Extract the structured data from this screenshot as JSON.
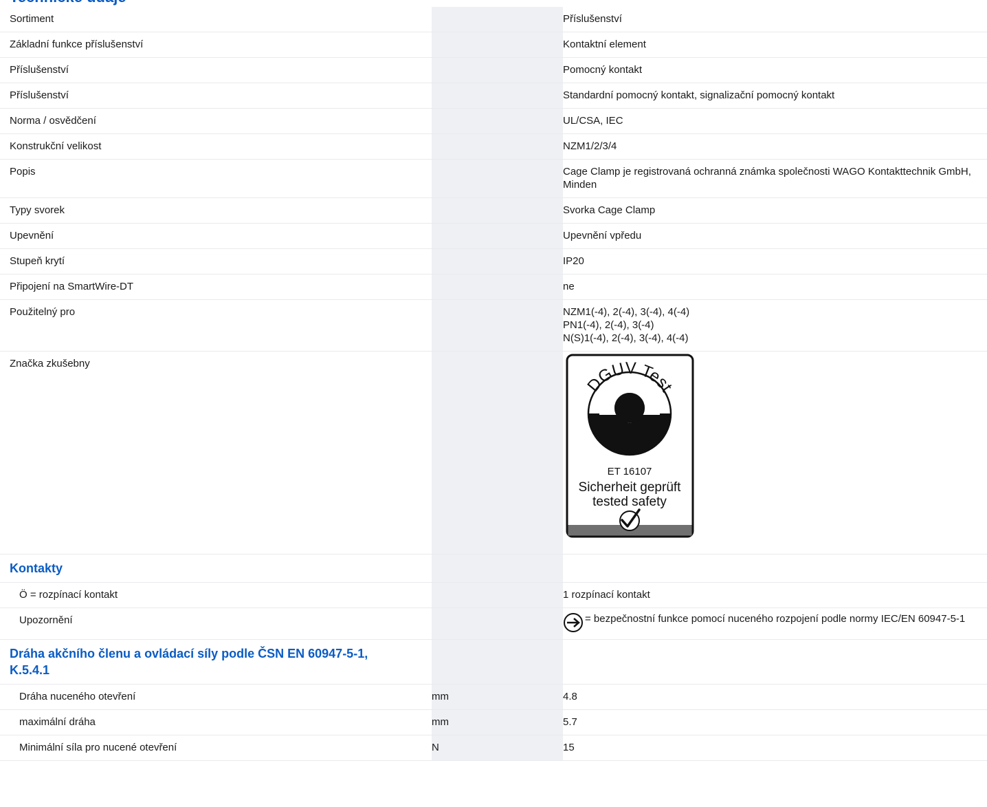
{
  "page": {
    "title_partial": "Technické údaje"
  },
  "general_rows": [
    {
      "label": "Sortiment",
      "unit": "",
      "value": "Příslušenství"
    },
    {
      "label": "Základní funkce příslušenství",
      "unit": "",
      "value": "Kontaktní element"
    },
    {
      "label": "Příslušenství",
      "unit": "",
      "value": "Pomocný kontakt"
    },
    {
      "label": "Příslušenství",
      "unit": "",
      "value": "Standardní pomocný kontakt, signalizační pomocný kontakt"
    },
    {
      "label": "Norma / osvědčení",
      "unit": "",
      "value": "UL/CSA, IEC"
    },
    {
      "label": "Konstrukční velikost",
      "unit": "",
      "value": "NZM1/2/3/4"
    },
    {
      "label": "Popis",
      "unit": "",
      "value": "Cage Clamp je registrovaná ochranná známka společnosti WAGO Kontakttechnik GmbH, Minden"
    },
    {
      "label": "Typy svorek",
      "unit": "",
      "value": "Svorka Cage Clamp"
    },
    {
      "label": "Upevnění",
      "unit": "",
      "value": "Upevnění vpředu"
    },
    {
      "label": "Stupeň krytí",
      "unit": "",
      "value": "IP20"
    },
    {
      "label": "Připojení na SmartWire-DT",
      "unit": "",
      "value": "ne"
    }
  ],
  "usable_for": {
    "label": "Použitelný pro",
    "lines": [
      "NZM1(-4), 2(-4), 3(-4), 4(-4)",
      "PN1(-4), 2(-4), 3(-4)",
      "N(S)1(-4), 2(-4), 3(-4), 4(-4)"
    ]
  },
  "test_mark": {
    "label": "Značka zkušebny",
    "logo": {
      "arc_text": "DGUV Test",
      "number": "ET 16107",
      "line1": "Sicherheit geprüft",
      "line2": "tested safety"
    }
  },
  "contacts": {
    "heading": "Kontakty",
    "rows": [
      {
        "label": "Ö = rozpínací kontakt",
        "value": "1 rozpínací kontakt"
      }
    ],
    "note": {
      "label": "Upozornění",
      "icon": "forced-opening-icon",
      "value": "= bezpečnostní funkce pomocí nuceného rozpojení podle normy IEC/EN 60947-5-1"
    }
  },
  "actuator": {
    "heading": "Dráha akčního členu a ovládací síly podle ČSN EN 60947-5-1, K.5.4.1",
    "rows": [
      {
        "label": "Dráha nuceného otevření",
        "unit": "mm",
        "value": "4.8"
      },
      {
        "label": "maximální dráha",
        "unit": "mm",
        "value": "5.7"
      },
      {
        "label": "Minimální síla pro nucené otevření",
        "unit": "N",
        "value": "15"
      }
    ]
  },
  "colors": {
    "accent": "#0a5cc4",
    "unit_column": "#eef0f4",
    "divider": "#e9eaee"
  }
}
